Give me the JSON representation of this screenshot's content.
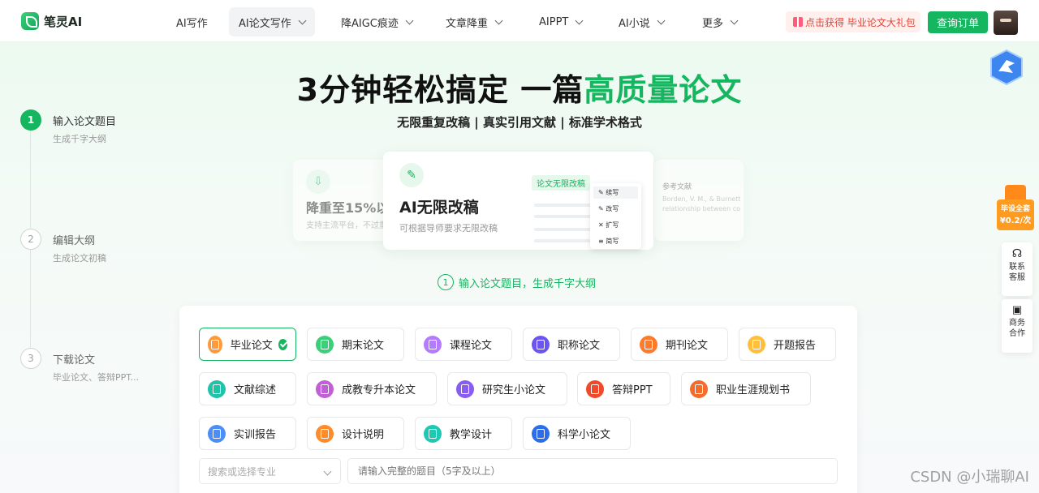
{
  "nav": {
    "logo_text": "笔灵AI",
    "items": [
      {
        "label": "AI写作"
      },
      {
        "label": "AI论文写作"
      },
      {
        "label": "降AIGC痕迹"
      },
      {
        "label": "文章降重"
      },
      {
        "label": "AIPPT"
      },
      {
        "label": "AI小说"
      },
      {
        "label": "更多"
      }
    ],
    "promo": "点击获得 毕业论文大礼包",
    "order_button": "查询订单"
  },
  "hero": {
    "title_part1": "3分钟轻松搞定 一篇",
    "title_highlight": "高质量论文",
    "subtitle": "无限重复改稿 | 真实引用文献 | 标准学术格式"
  },
  "steps": [
    {
      "num": "1",
      "title": "输入论文题目",
      "desc": "生成千字大纲"
    },
    {
      "num": "2",
      "title": "编辑大纲",
      "desc": "生成论文初稿"
    },
    {
      "num": "3",
      "title": "下载论文",
      "desc": "毕业论文、答辩PPT..."
    }
  ],
  "feature_cards": {
    "left_title": "降重至15%以",
    "left_desc": "支持主流平台，不过重",
    "main_title": "AI无限改稿",
    "main_desc": "可根据导师要求无限改稿",
    "tag": "论文无限改稿",
    "menu": [
      "续写",
      "改写",
      "扩写",
      "简写"
    ],
    "right_title": "参考文献",
    "right_line1": "Borden, V. M., & Burnett, A. W.",
    "right_line2": "relationship between college"
  },
  "section_label": {
    "num": "1",
    "text": "输入论文题目，生成千字大纲"
  },
  "paper_types": [
    {
      "label": "毕业论文",
      "color": "#ff9a3c"
    },
    {
      "label": "期末论文",
      "color": "#3ccf7a"
    },
    {
      "label": "课程论文",
      "color": "#b57bff"
    },
    {
      "label": "职称论文",
      "color": "#6b55f0"
    },
    {
      "label": "期刊论文",
      "color": "#ff7a2b"
    },
    {
      "label": "开题报告",
      "color": "#ffbf3c"
    },
    {
      "label": "文献综述",
      "color": "#1fc4a8"
    },
    {
      "label": "成教专升本论文",
      "color": "#c25ed8"
    },
    {
      "label": "研究生小论文",
      "color": "#8a5cf0"
    },
    {
      "label": "答辩PPT",
      "color": "#f04a2b"
    },
    {
      "label": "职业生涯规划书",
      "color": "#f56b2b"
    },
    {
      "label": "实训报告",
      "color": "#4d8ef5"
    },
    {
      "label": "设计说明",
      "color": "#ff8b2b"
    },
    {
      "label": "教学设计",
      "color": "#1ec8b3"
    },
    {
      "label": "科学小论文",
      "color": "#2d6de8"
    }
  ],
  "selected_type": "毕业论文",
  "form": {
    "major_placeholder": "搜索或选择专业",
    "topic_placeholder": "请输入完整的题目（5字及以上）"
  },
  "side": {
    "promo_line1": "毕设全套",
    "promo_line2": "¥0.2/次",
    "service": "联系客服",
    "business": "商务合作"
  },
  "watermark": "CSDN @小瑞聊AI",
  "colors": {
    "brand": "#16b560",
    "promo_text": "#e0463a"
  }
}
